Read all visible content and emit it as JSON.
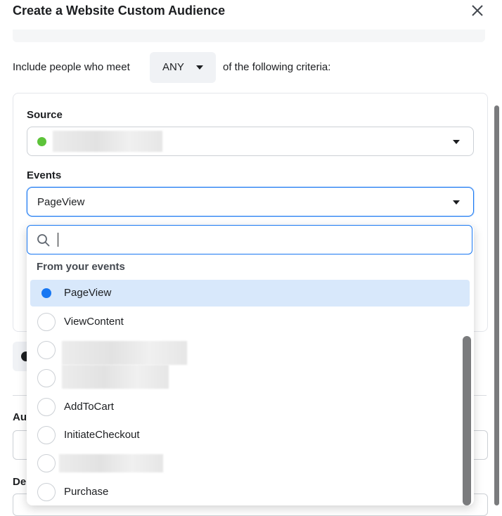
{
  "dialog": {
    "title": "Create a Website Custom Audience",
    "close_icon": "close-icon"
  },
  "criteria": {
    "prefix": "Include people who meet",
    "match_value": "ANY",
    "suffix": "of the following criteria:"
  },
  "source": {
    "label": "Source",
    "status_color": "#5dc33a"
  },
  "events": {
    "label": "Events",
    "selected": "PageView"
  },
  "dropdown": {
    "search_value": "",
    "section_header": "From your events",
    "options": [
      {
        "label": "PageView",
        "selected": true
      },
      {
        "label": "ViewContent",
        "selected": false
      },
      {
        "label": "",
        "selected": false
      },
      {
        "label": "",
        "selected": false
      },
      {
        "label": "AddToCart",
        "selected": false
      },
      {
        "label": "InitiateCheckout",
        "selected": false
      },
      {
        "label": "",
        "selected": false
      },
      {
        "label": "Purchase",
        "selected": false
      }
    ]
  },
  "background_fields": {
    "audience_label_partial": "Au",
    "description_label_partial": "De"
  },
  "colors": {
    "accent": "#1877f2",
    "selected_row": "#d8e8fb"
  }
}
